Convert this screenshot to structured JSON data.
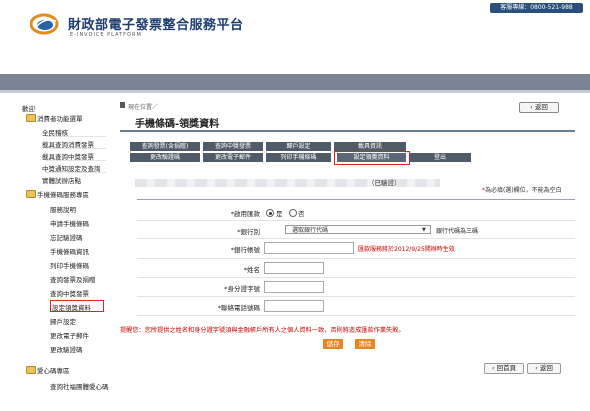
{
  "header": {
    "hotline": "客服專線：0800-521-988",
    "title": "財政部電子發票整合服務平台",
    "subtitle": "E-INVOICE PLATFORM"
  },
  "sidebar": {
    "welcome": "歡迎",
    "groups": [
      {
        "label": "消費者功能選單"
      },
      {
        "label": "手機條碼服務專區"
      },
      {
        "label": "愛心碼專區"
      }
    ],
    "items1": [
      "全民稽核",
      "載具查詢消費發票",
      "載具查詢中獎發票",
      "中獎通知設定及查詢",
      "實體試辦店點"
    ],
    "items2": [
      "服務說明",
      "申請手機條碼",
      "忘記驗證碼",
      "手機條碼資訊",
      "列印手機條碼",
      "查詢發票及捐贈",
      "查詢中獎發票",
      "設定領獎資料",
      "歸戶設定",
      "更改電子郵件",
      "更改驗證碼"
    ],
    "items3": [
      "查詢社福團體愛心碼"
    ]
  },
  "breadcrumb": "現在位置／",
  "back_label": "返回",
  "page_title": "手機條碼-領獎資料",
  "tabs_row1": [
    "查詢發票(含捐贈)",
    "查詢中獎發票",
    "歸戶設定",
    "載具資訊"
  ],
  "tabs_row2": [
    "更改驗證碼",
    "更改電子郵件",
    "列印手機條碼",
    "設定領獎資料",
    "登出"
  ],
  "user_status": "（已驗證）",
  "required_note": {
    "star": "*",
    "text": "為必填(選)欄位，不能為空白"
  },
  "form": {
    "enable_label": "*啟用匯款",
    "enable_yes": "是",
    "enable_no": "否",
    "bank_label": "*銀行別",
    "bank_placeholder": "選取銀行代碼",
    "bank_hint": "銀行代碼為三碼",
    "account_label": "*銀行帳號",
    "account_hint": "匯款服務將於2012/9/25開辦時生效",
    "name_label": "*姓名",
    "id_label": "*身分證字號",
    "phone_label": "*聯絡電話號碼"
  },
  "warning": "提醒您：您所提供之姓名和身分證字號須與金融帳戶所有人之個人資料一致，否則將造成匯款作業失敗。",
  "buttons": {
    "save": "儲存",
    "clear": "清除"
  },
  "bottom": {
    "home": "回首頁",
    "back": "返回"
  },
  "colors": {
    "tab_bg": "#4f5b68",
    "nav_band": "#7a8593",
    "accent_red": "#cc0000",
    "button_orange": "#e9851c"
  }
}
